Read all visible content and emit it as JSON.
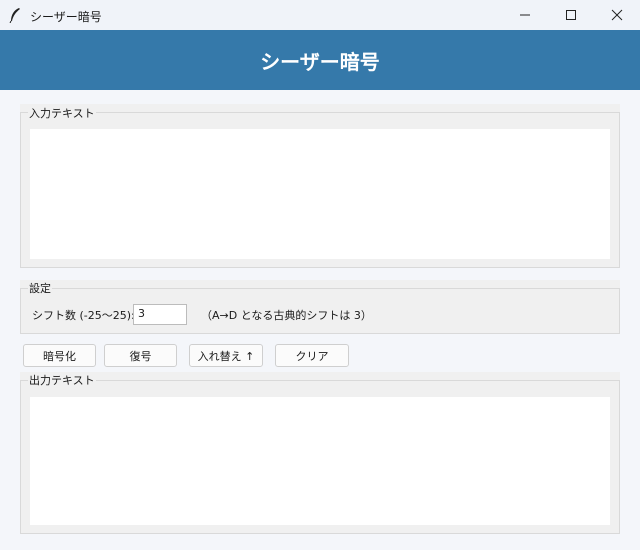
{
  "window": {
    "title": "シーザー暗号",
    "icon": "feather-icon"
  },
  "header": {
    "title": "シーザー暗号",
    "background": "#3579aa"
  },
  "input_section": {
    "legend": "入力テキスト",
    "value": ""
  },
  "settings": {
    "legend": "設定",
    "shift_label": "シフト数 (-25〜25):",
    "shift_value": "3",
    "note": "（A→D となる古典的シフトは 3）"
  },
  "buttons": {
    "encrypt": "暗号化",
    "decrypt": "復号",
    "swap": "入れ替え ↑",
    "clear": "クリア"
  },
  "output_section": {
    "legend": "出力テキスト",
    "value": ""
  }
}
